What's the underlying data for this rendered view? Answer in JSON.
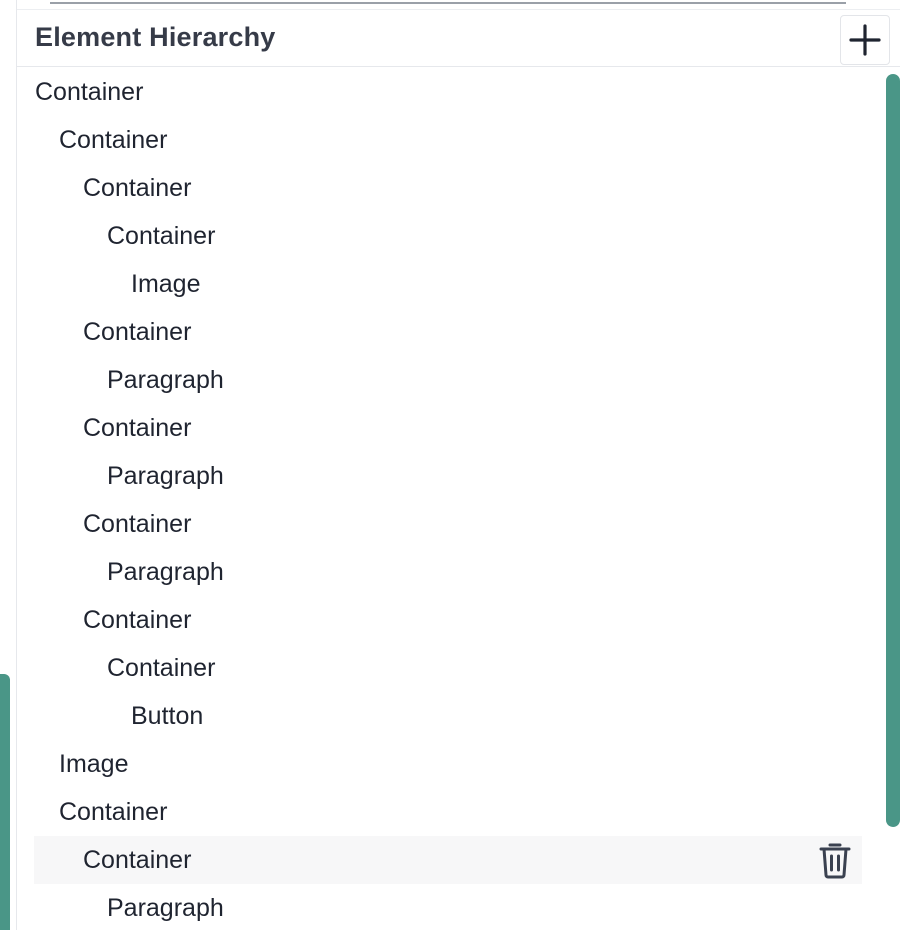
{
  "panel": {
    "title": "Element Hierarchy",
    "add_icon": "plus-icon",
    "delete_icon": "trash-icon",
    "accent_color": "#4a9687"
  },
  "tree": [
    {
      "label": "Container",
      "depth": 0
    },
    {
      "label": "Container",
      "depth": 1
    },
    {
      "label": "Container",
      "depth": 2
    },
    {
      "label": "Container",
      "depth": 3
    },
    {
      "label": "Image",
      "depth": 4
    },
    {
      "label": "Container",
      "depth": 2
    },
    {
      "label": "Paragraph",
      "depth": 3
    },
    {
      "label": "Container",
      "depth": 2
    },
    {
      "label": "Paragraph",
      "depth": 3
    },
    {
      "label": "Container",
      "depth": 2
    },
    {
      "label": "Paragraph",
      "depth": 3
    },
    {
      "label": "Container",
      "depth": 2
    },
    {
      "label": "Container",
      "depth": 3
    },
    {
      "label": "Button",
      "depth": 4
    },
    {
      "label": "Image",
      "depth": 1
    },
    {
      "label": "Container",
      "depth": 1
    },
    {
      "label": "Container",
      "depth": 2,
      "selected": true
    },
    {
      "label": "Paragraph",
      "depth": 3
    }
  ]
}
